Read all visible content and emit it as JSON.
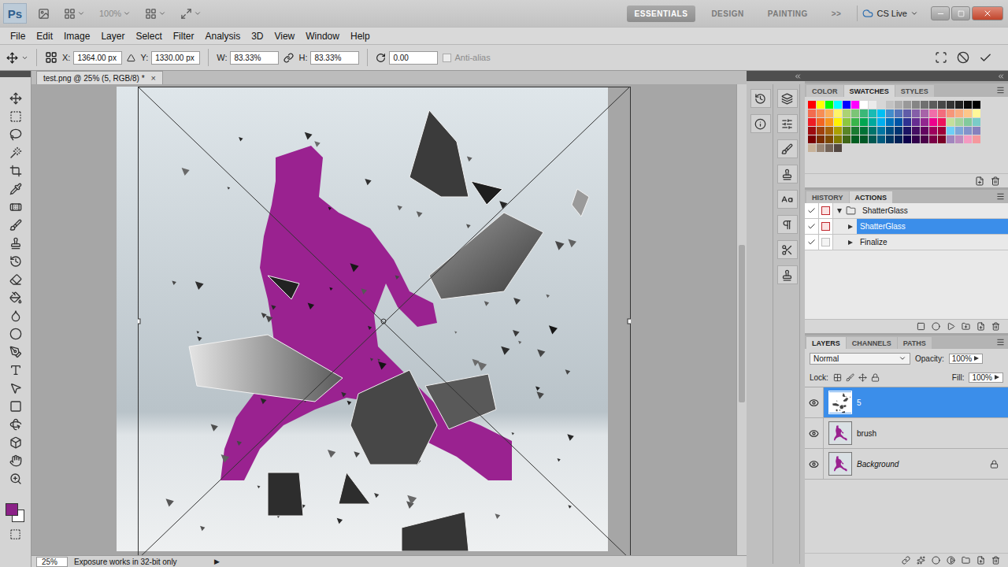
{
  "app": {
    "logo": "Ps",
    "zoom": "100%",
    "workspaces": [
      {
        "label": "ESSENTIALS",
        "selected": true
      },
      {
        "label": "DESIGN",
        "selected": false
      },
      {
        "label": "PAINTING",
        "selected": false
      }
    ],
    "more": ">>",
    "cs_live": "CS Live"
  },
  "menu": [
    "File",
    "Edit",
    "Image",
    "Layer",
    "Select",
    "Filter",
    "Analysis",
    "3D",
    "View",
    "Window",
    "Help"
  ],
  "options": {
    "x": {
      "label": "X:",
      "value": "1364.00 px"
    },
    "y": {
      "label": "Y:",
      "value": "1330.00 px"
    },
    "w": {
      "label": "W:",
      "value": "83.33%"
    },
    "h": {
      "label": "H:",
      "value": "83.33%"
    },
    "angle": "0.00",
    "checkbox": {
      "label": "Anti-alias",
      "checked": false,
      "disabled": true
    }
  },
  "tools": {
    "foreground": "#8b2187",
    "background": "#ffffff"
  },
  "document": {
    "title": "test.png @ 25% (5, RGB/8) *",
    "close": "×"
  },
  "status_bar": {
    "zoom": "25%",
    "info": "Exposure works in 32-bit only",
    "menu": "▶"
  },
  "swatches_panel": {
    "tabs": [
      {
        "label": "COLOR",
        "selected": false
      },
      {
        "label": "SWATCHES",
        "selected": true
      },
      {
        "label": "STYLES",
        "selected": false
      }
    ],
    "swatches": [
      {
        "color": "#ff0000"
      },
      {
        "color": "#ffff00"
      },
      {
        "color": "#00ff00"
      },
      {
        "color": "#00ffff"
      },
      {
        "color": "#0000ff"
      },
      {
        "color": "#ff00ff"
      },
      {
        "color": "#ffffff"
      },
      {
        "color": "#ebebeb"
      },
      {
        "color": "#d6d6d6"
      },
      {
        "color": "#c2c2c2"
      },
      {
        "color": "#adadad"
      },
      {
        "color": "#999999"
      },
      {
        "color": "#858585"
      },
      {
        "color": "#707070"
      },
      {
        "color": "#5c5c5c"
      },
      {
        "color": "#474747"
      },
      {
        "color": "#333333"
      },
      {
        "color": "#1f1f1f"
      },
      {
        "color": "#0a0a0a"
      },
      {
        "color": "#000000"
      },
      {
        "color": "#f26c4f"
      },
      {
        "color": "#f68e55"
      },
      {
        "color": "#fbaf5c"
      },
      {
        "color": "#fff467"
      },
      {
        "color": "#acd372"
      },
      {
        "color": "#7cc576"
      },
      {
        "color": "#3bb878"
      },
      {
        "color": "#1abbb4"
      },
      {
        "color": "#00bff3"
      },
      {
        "color": "#438ccb"
      },
      {
        "color": "#5574b9"
      },
      {
        "color": "#605ca8"
      },
      {
        "color": "#855fa8"
      },
      {
        "color": "#a763a8"
      },
      {
        "color": "#f06ea9"
      },
      {
        "color": "#f26d7d"
      },
      {
        "color": "#f69679"
      },
      {
        "color": "#f9ad81"
      },
      {
        "color": "#fdc689"
      },
      {
        "color": "#fff799"
      },
      {
        "color": "#ed1c24"
      },
      {
        "color": "#f26522"
      },
      {
        "color": "#f7941d"
      },
      {
        "color": "#fff200"
      },
      {
        "color": "#8dc73f"
      },
      {
        "color": "#39b54a"
      },
      {
        "color": "#00a651"
      },
      {
        "color": "#00a99d"
      },
      {
        "color": "#00aeef"
      },
      {
        "color": "#0072bc"
      },
      {
        "color": "#0054a6"
      },
      {
        "color": "#2e3192"
      },
      {
        "color": "#662d91"
      },
      {
        "color": "#92278f"
      },
      {
        "color": "#ec008c"
      },
      {
        "color": "#ed145b"
      },
      {
        "color": "#c4df9b"
      },
      {
        "color": "#a3d39c"
      },
      {
        "color": "#82ca9c"
      },
      {
        "color": "#7accc8"
      },
      {
        "color": "#9e0b0f"
      },
      {
        "color": "#a0410d"
      },
      {
        "color": "#a3620a"
      },
      {
        "color": "#aba000"
      },
      {
        "color": "#598527"
      },
      {
        "color": "#197b30"
      },
      {
        "color": "#007236"
      },
      {
        "color": "#00746b"
      },
      {
        "color": "#0076a3"
      },
      {
        "color": "#004b80"
      },
      {
        "color": "#003471"
      },
      {
        "color": "#1b1464"
      },
      {
        "color": "#440e62"
      },
      {
        "color": "#630460"
      },
      {
        "color": "#9e005d"
      },
      {
        "color": "#9e0039"
      },
      {
        "color": "#6dcff6"
      },
      {
        "color": "#7da7d9"
      },
      {
        "color": "#8393ca"
      },
      {
        "color": "#8781bd"
      },
      {
        "color": "#790000"
      },
      {
        "color": "#7b2e00"
      },
      {
        "color": "#7d4900"
      },
      {
        "color": "#827b00"
      },
      {
        "color": "#406618"
      },
      {
        "color": "#005e20"
      },
      {
        "color": "#005826"
      },
      {
        "color": "#005952"
      },
      {
        "color": "#005b7f"
      },
      {
        "color": "#003663"
      },
      {
        "color": "#002157"
      },
      {
        "color": "#0d004c"
      },
      {
        "color": "#32004b"
      },
      {
        "color": "#4b0049"
      },
      {
        "color": "#7b0046"
      },
      {
        "color": "#7a0026"
      },
      {
        "color": "#a186be"
      },
      {
        "color": "#bd8cbf"
      },
      {
        "color": "#f49ac1"
      },
      {
        "color": "#f5989d"
      },
      {
        "color": "#c7b299"
      },
      {
        "color": "#998675"
      },
      {
        "color": "#736357"
      },
      {
        "color": "#534741"
      }
    ]
  },
  "actions_panel": {
    "tabs": [
      {
        "label": "HISTORY",
        "selected": false
      },
      {
        "label": "ACTIONS",
        "selected": true
      }
    ],
    "rows": [
      {
        "name": "ShatterGlass",
        "kind": "set",
        "checked": true,
        "dialog": true,
        "expanded": true,
        "selected": false
      },
      {
        "name": "ShatterGlass",
        "kind": "action",
        "checked": true,
        "dialog": true,
        "expanded": false,
        "selected": true
      },
      {
        "name": "Finalize",
        "kind": "action",
        "checked": true,
        "dialog": false,
        "expanded": false,
        "selected": false
      }
    ]
  },
  "layers_panel": {
    "tabs": [
      {
        "label": "LAYERS",
        "selected": true
      },
      {
        "label": "CHANNELS",
        "selected": false
      },
      {
        "label": "PATHS",
        "selected": false
      }
    ],
    "blend_mode": "Normal",
    "opacity_label": "Opacity:",
    "opacity": "100%",
    "lock_label": "Lock:",
    "fill_label": "Fill:",
    "fill": "100%",
    "layers": [
      {
        "name": "5",
        "visible": true,
        "selected": true,
        "locked": false,
        "italic": false
      },
      {
        "name": "brush",
        "visible": true,
        "selected": false,
        "locked": false,
        "italic": false
      },
      {
        "name": "Background",
        "visible": true,
        "selected": false,
        "locked": true,
        "italic": true
      }
    ]
  }
}
